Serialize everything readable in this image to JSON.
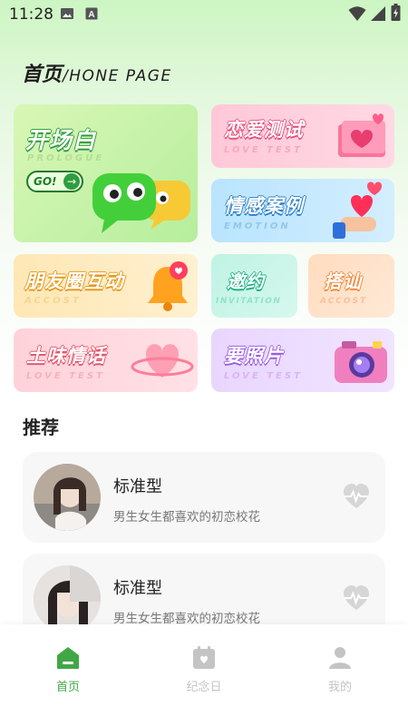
{
  "status_bar": {
    "time": "11:28",
    "icons": [
      "image-icon",
      "a-badge-icon",
      "wifi-icon",
      "signal-icon",
      "battery-charging-icon"
    ]
  },
  "header": {
    "title_cn": "首页",
    "title_en": "/HONE PAGE"
  },
  "cards": {
    "prologue": {
      "title": "开场白",
      "subtitle": "PROLOGUE",
      "button": "GO!",
      "button_arrow": "→",
      "title_color": "#ffffff",
      "subtitle_color": "#b4de96"
    },
    "love_test": {
      "title": "恋爱测试",
      "subtitle": "LOVE TEST",
      "subtitle_color": "#f6a9bf"
    },
    "emotion": {
      "title": "情感案例",
      "subtitle": "EMOTION",
      "subtitle_color": "#92c7ec"
    },
    "moments": {
      "title": "朋友圈互动",
      "subtitle": "ACCOST",
      "subtitle_color": "#f6d58e"
    },
    "invitation": {
      "title": "邀约",
      "subtitle": "INVITATION",
      "subtitle_color": "#92e2cc"
    },
    "accost": {
      "title": "搭讪",
      "subtitle": "ACCOST",
      "subtitle_color": "#f7c09c"
    },
    "love_words": {
      "title": "土味情话",
      "subtitle": "LOVE TEST",
      "subtitle_color": "#f6b1be"
    },
    "photo": {
      "title": "要照片",
      "subtitle": "LOVE TEST",
      "subtitle_color": "#d6b6f4"
    }
  },
  "recommend": {
    "title": "推荐",
    "items": [
      {
        "name": "标准型",
        "desc": "男生女生都喜欢的初恋校花"
      },
      {
        "name": "标准型",
        "desc": "男生女生都喜欢的初恋校花"
      }
    ]
  },
  "nav": {
    "items": [
      {
        "label": "首页",
        "icon": "home-icon",
        "active": true
      },
      {
        "label": "纪念日",
        "icon": "calendar-heart-icon",
        "active": false
      },
      {
        "label": "我的",
        "icon": "user-icon",
        "active": false
      }
    ],
    "active_color": "#3fa845",
    "inactive_color": "#c4c4c4"
  },
  "colors": {
    "accent": "#3fa845"
  }
}
